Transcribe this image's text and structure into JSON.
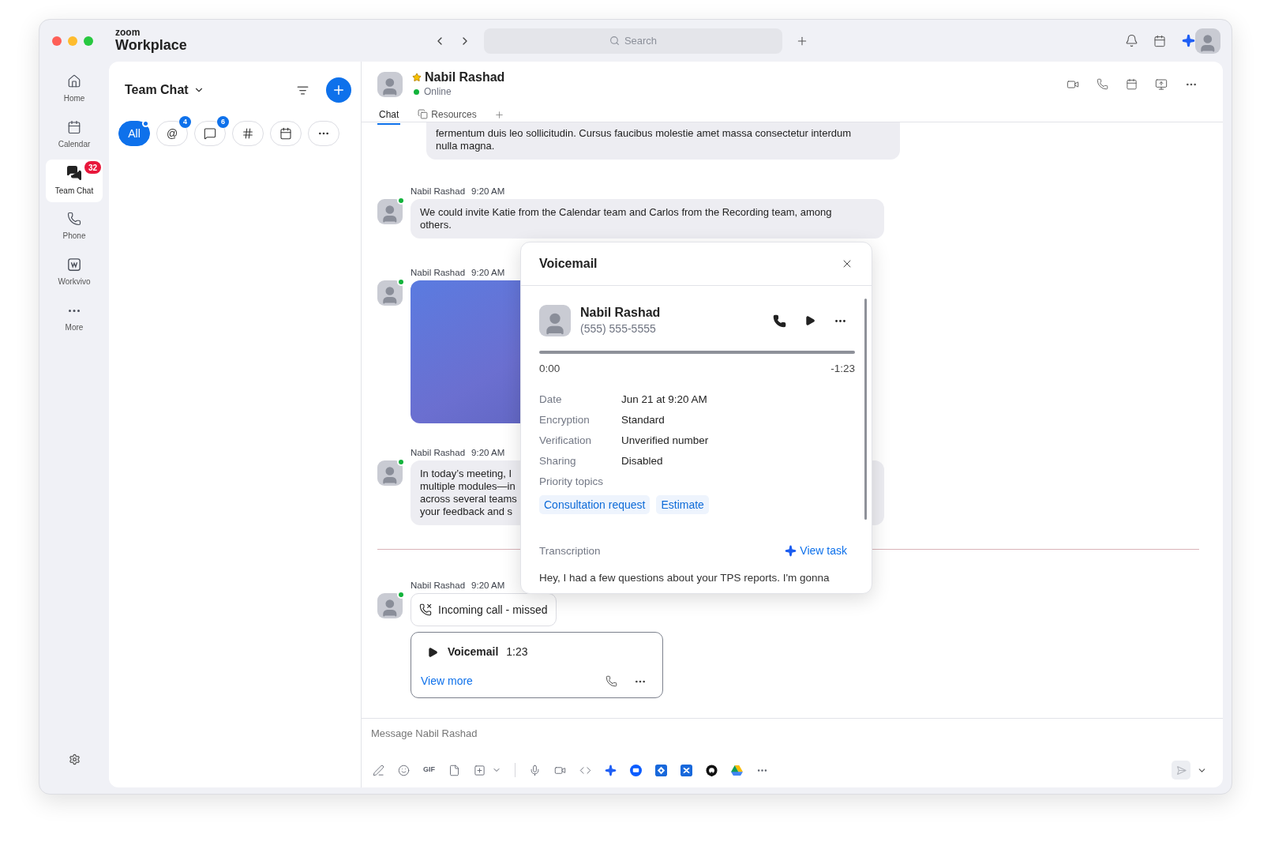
{
  "window": {
    "brand_top": "zoom",
    "brand": "Workplace"
  },
  "search": {
    "placeholder": "Search"
  },
  "nav": [
    {
      "kind": "home",
      "label": "Home",
      "selected": false
    },
    {
      "kind": "calendar",
      "label": "Calendar",
      "selected": false
    },
    {
      "kind": "chat",
      "label": "Team Chat",
      "selected": true,
      "badge": "32"
    },
    {
      "kind": "phone",
      "label": "Phone",
      "selected": false
    },
    {
      "kind": "workvivo",
      "label": "Workvivo",
      "selected": false
    },
    {
      "kind": "more",
      "label": "More",
      "selected": false
    }
  ],
  "panel": {
    "title": "Team Chat",
    "filters": [
      {
        "kind": "all",
        "label": "All",
        "selected": true,
        "dot": true
      },
      {
        "kind": "mention",
        "label": "@",
        "selected": false,
        "badge": "4"
      },
      {
        "kind": "chat",
        "selected": false,
        "badge": "6"
      },
      {
        "kind": "channel",
        "selected": false
      },
      {
        "kind": "calendar",
        "selected": false
      },
      {
        "kind": "more",
        "selected": false
      }
    ]
  },
  "chat": {
    "name": "Nabil Rashad",
    "starred": true,
    "status": "Online",
    "tabs": [
      {
        "kind": "chat",
        "label": "Chat",
        "selected": true
      },
      {
        "kind": "resources",
        "label": "Resources",
        "selected": false
      }
    ]
  },
  "messages": [
    {
      "kind": "fragment",
      "lines": [
        "fermentum duis leo sollicitudin. Cursus faucibus molestie amet massa consectetur interdum",
        "nulla magna."
      ]
    },
    {
      "kind": "text",
      "sender": "Nabil Rashad",
      "time": "9:20 AM",
      "online": true,
      "lines": [
        "We could invite Katie from the Calendar team and Carlos from the Recording team, among",
        "others."
      ]
    },
    {
      "kind": "image",
      "sender": "Nabil Rashad",
      "time": "9:20 AM",
      "online": true
    },
    {
      "kind": "text",
      "sender": "Nabil Rashad",
      "time": "9:20 AM",
      "online": true,
      "lines": [
        "In today’s meeting, I",
        "multiple modules—in",
        "across several teams",
        "your feedback and s"
      ]
    },
    {
      "kind": "divider"
    },
    {
      "kind": "call",
      "sender": "Nabil Rashad",
      "time": "9:20 AM",
      "online": true,
      "call": "Incoming call - missed",
      "voicemail": {
        "title": "Voicemail",
        "duration": "1:23",
        "link": "View more"
      }
    }
  ],
  "popup": {
    "title": "Voicemail",
    "caller": "Nabil Rashad",
    "phone": "(555) 555-5555",
    "level": 0,
    "elapsed": "0:00",
    "remaining": "-1:23",
    "details": [
      {
        "label": "Date",
        "value": "Jun 21 at 9:20 AM"
      },
      {
        "label": "Encryption",
        "value": "Standard"
      },
      {
        "label": "Verification",
        "value": "Unverified number"
      },
      {
        "label": "Sharing",
        "value": "Disabled"
      }
    ],
    "topics_label": "Priority topics",
    "topics": [
      "Consultation request",
      "Estimate"
    ],
    "transcription_label": "Transcription",
    "action": "View task",
    "transcript": "Hey, I had a few questions about your TPS reports. I'm gonna"
  },
  "composer": {
    "placeholder": "Message Nabil Rashad",
    "gif": "GIF"
  }
}
